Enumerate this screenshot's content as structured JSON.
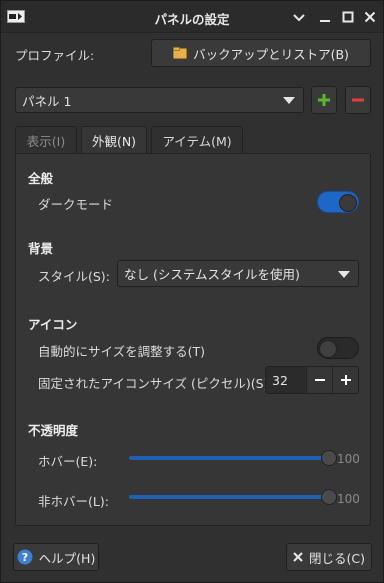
{
  "window": {
    "title": "パネルの設定",
    "controls": [
      "minimize-icon",
      "maximize-icon",
      "close-icon"
    ]
  },
  "profile": {
    "label": "プロファイル:",
    "backup_button": "バックアップとリストア(B)",
    "backup_icon": "folder-icon"
  },
  "panel_select": {
    "value": "パネル 1",
    "add_icon": "plus-icon",
    "remove_icon": "minus-icon"
  },
  "tabs": [
    {
      "label": "表示(I)",
      "state": "disabled"
    },
    {
      "label": "外観(N)",
      "state": "active"
    },
    {
      "label": "アイテム(M)",
      "state": "normal"
    }
  ],
  "general": {
    "heading": "全般",
    "dark_mode_label": "ダークモード",
    "dark_mode_on": true
  },
  "background": {
    "heading": "背景",
    "style_label": "スタイル(S):",
    "style_value": "なし (システムスタイルを使用)"
  },
  "icons": {
    "heading": "アイコン",
    "auto_size_label": "自動的にサイズを調整する(T)",
    "auto_size_on": false,
    "fixed_size_label": "固定されたアイコンサイズ (ピクセル)(S):",
    "fixed_size_value": "32"
  },
  "opacity": {
    "heading": "不透明度",
    "hover_label": "ホバー(E):",
    "hover_value": "100",
    "non_hover_label": "非ホバー(L):",
    "non_hover_value": "100"
  },
  "footer": {
    "help_button": "ヘルプ(H)",
    "help_icon": "help-icon",
    "close_button": "閉じる(C)",
    "close_icon": "close-icon"
  },
  "colors": {
    "accent": "#1e67c6",
    "add_green": "#5cb82b",
    "remove_red": "#e0413a",
    "background": "#303030"
  }
}
